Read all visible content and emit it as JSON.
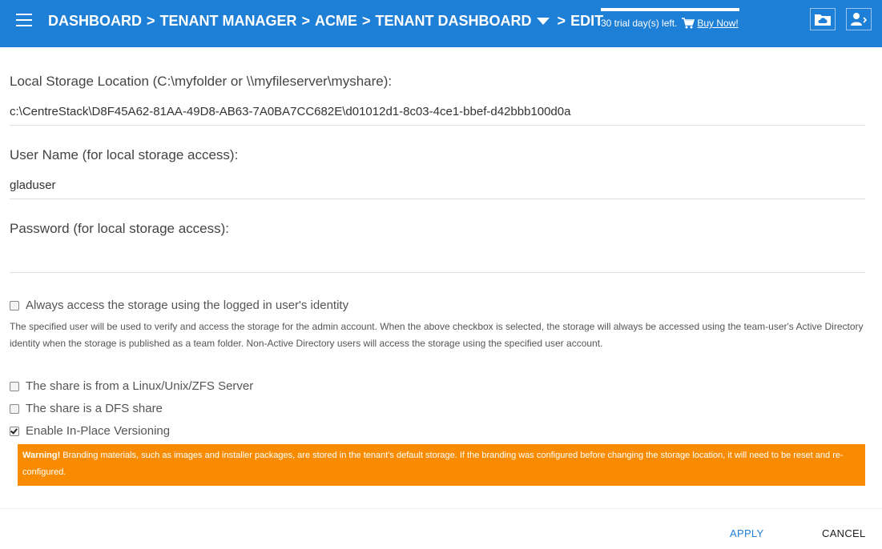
{
  "header": {
    "breadcrumb": [
      "DASHBOARD",
      "TENANT MANAGER",
      "ACME",
      "TENANT DASHBOARD",
      "EDIT"
    ],
    "separator": ">",
    "trial_text": "30 trial day(s) left.",
    "buy_label": "Buy Now!",
    "background_color": "#1e7fd6",
    "icons": [
      "menu-icon",
      "dropdown-caret-icon",
      "cart-icon",
      "folder-cloud-icon",
      "user-switch-icon"
    ]
  },
  "form": {
    "storage_location_label": "Local Storage Location (C:\\myfolder or \\\\myfileserver\\myshare):",
    "storage_location_value": "c:\\CentreStack\\D8F45A62-81AA-49D8-AB63-7A0BA7CC682E\\d01012d1-8c03-4ce1-bbef-d42bbb100d0a",
    "username_label": "User Name (for local storage access):",
    "username_value": "gladuser",
    "password_label": "Password (for local storage access):",
    "password_value": "",
    "identity_checkbox": {
      "label": "Always access the storage using the logged in user's identity",
      "checked": false
    },
    "help_text": "The specified user will be used to verify and access the storage for the admin account. When the above checkbox is selected, the storage will always be accessed using the team-user's Active Directory identity when the storage is published as a team folder. Non-Active Directory users will access the storage using the specified user account.",
    "linux_checkbox": {
      "label": "The share is from a Linux/Unix/ZFS Server",
      "checked": false
    },
    "dfs_checkbox": {
      "label": "The share is a DFS share",
      "checked": false
    },
    "versioning_checkbox": {
      "label": "Enable In-Place Versioning",
      "checked": true
    }
  },
  "warning": {
    "prefix": "Warning!",
    "text": " Branding materials, such as images and installer packages, are stored in the tenant's default storage. If the branding was configured before changing the storage location, it will need to be reset and re-configured.",
    "color": "#f98b00"
  },
  "actions": {
    "apply_label": "APPLY",
    "cancel_label": "CANCEL",
    "apply_color": "#1e7fd6"
  }
}
